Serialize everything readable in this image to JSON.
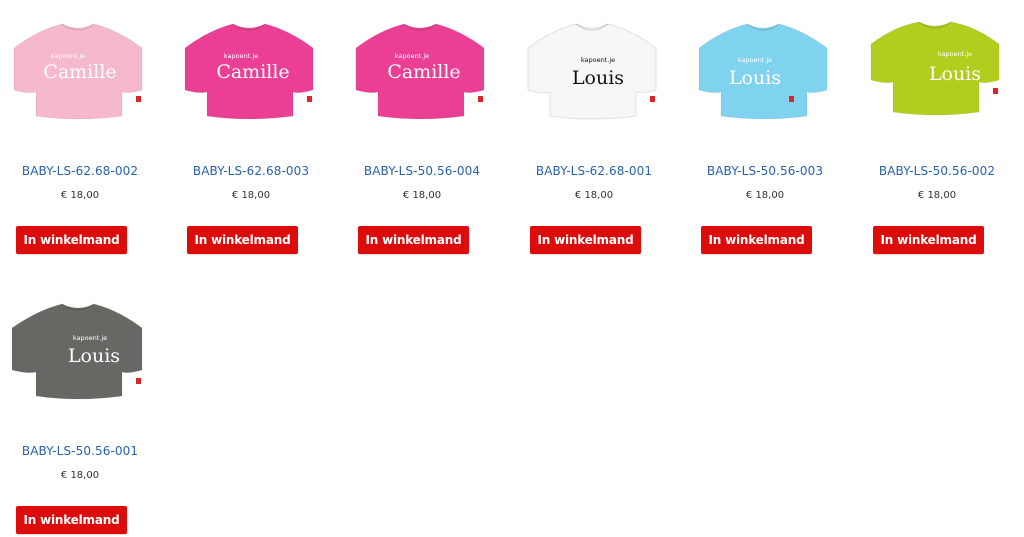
{
  "products": [
    {
      "sku": "BABY-LS-62.68-002",
      "price": "€ 18,00",
      "cart_label": "In winkelmand",
      "shirt_color": "#f6b8cc",
      "text_color": "#ffffff",
      "brand_print": "kapoent.je",
      "name_print": "Camille"
    },
    {
      "sku": "BABY-LS-62.68-003",
      "price": "€ 18,00",
      "cart_label": "In winkelmand",
      "shirt_color": "#ea3f95",
      "text_color": "#ffffff",
      "brand_print": "kapoent.je",
      "name_print": "Camille"
    },
    {
      "sku": "BABY-LS-50.56-004",
      "price": "€ 18,00",
      "cart_label": "In winkelmand",
      "shirt_color": "#ea3f95",
      "text_color": "#ffffff",
      "brand_print": "kapoent.je",
      "name_print": "Camille"
    },
    {
      "sku": "BABY-LS-62.68-001",
      "price": "€ 18,00",
      "cart_label": "In winkelmand",
      "shirt_color": "#f7f7f7",
      "text_color": "#111111",
      "brand_print": "kapoent.je",
      "name_print": "Louis"
    },
    {
      "sku": "BABY-LS-50.56-003",
      "price": "€ 18,00",
      "cart_label": "In winkelmand",
      "shirt_color": "#80d3ee",
      "text_color": "#ffffff",
      "brand_print": "kapoent.je",
      "name_print": "Louis"
    },
    {
      "sku": "BABY-LS-50.56-002",
      "price": "€ 18,00",
      "cart_label": "In winkelmand",
      "shirt_color": "#b3cd1f",
      "text_color": "#ffffff",
      "brand_print": "kapoent.je",
      "name_print": "Louis"
    },
    {
      "sku": "BABY-LS-50.56-001",
      "price": "€ 18,00",
      "cart_label": "In winkelmand",
      "shirt_color": "#666963",
      "text_color": "#ffffff",
      "brand_print": "kapoent.je",
      "name_print": "Louis"
    }
  ],
  "colors": {
    "button_bg": "#dc0c0c",
    "button_text": "#ffffff",
    "sku_link": "#2a62a8",
    "price_text": "#333333",
    "label_tag": "#d9262b"
  },
  "icons": {
    "thumbnail": "tshirt-image"
  }
}
